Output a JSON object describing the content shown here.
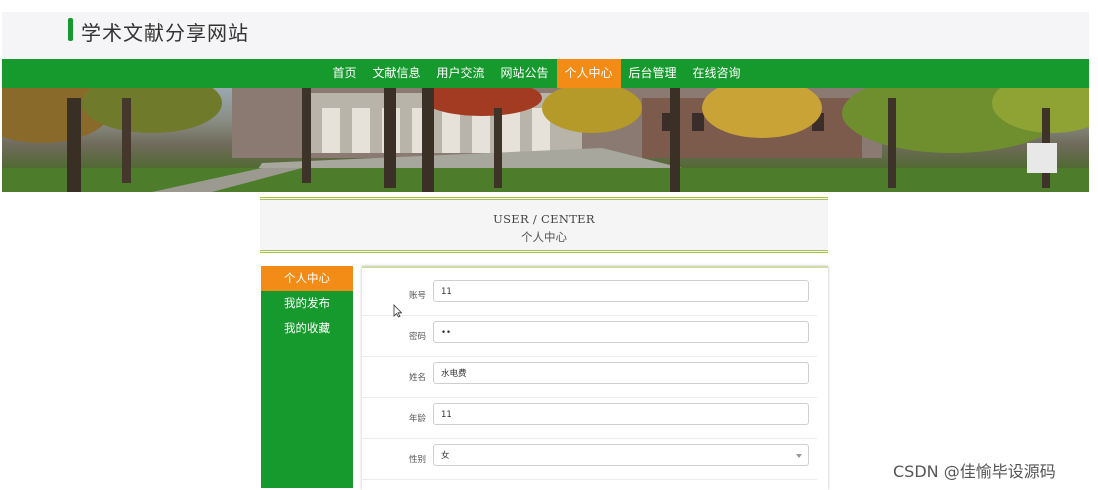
{
  "header": {
    "title": "学术文献分享网站"
  },
  "nav": {
    "items": [
      {
        "label": "首页",
        "active": false
      },
      {
        "label": "文献信息",
        "active": false
      },
      {
        "label": "用户交流",
        "active": false
      },
      {
        "label": "网站公告",
        "active": false
      },
      {
        "label": "个人中心",
        "active": true
      },
      {
        "label": "后台管理",
        "active": false
      },
      {
        "label": "在线咨询",
        "active": false
      }
    ]
  },
  "user_center": {
    "title_en": "USER / CENTER",
    "title_zh": "个人中心"
  },
  "sidebar": {
    "items": [
      {
        "label": "个人中心",
        "active": true
      },
      {
        "label": "我的发布",
        "active": false
      },
      {
        "label": "我的收藏",
        "active": false
      }
    ]
  },
  "form": {
    "fields": [
      {
        "label": "账号",
        "value": "11",
        "type": "text"
      },
      {
        "label": "密码",
        "value": "••",
        "type": "password"
      },
      {
        "label": "姓名",
        "value": "水电费",
        "type": "text"
      },
      {
        "label": "年龄",
        "value": "11",
        "type": "text"
      },
      {
        "label": "性别",
        "value": "女",
        "type": "select"
      }
    ]
  },
  "watermark": "CSDN @佳愉毕设源码",
  "colors": {
    "primary_green": "#169a2e",
    "active_orange": "#f38b17",
    "accent_olive": "#a5c24a"
  }
}
